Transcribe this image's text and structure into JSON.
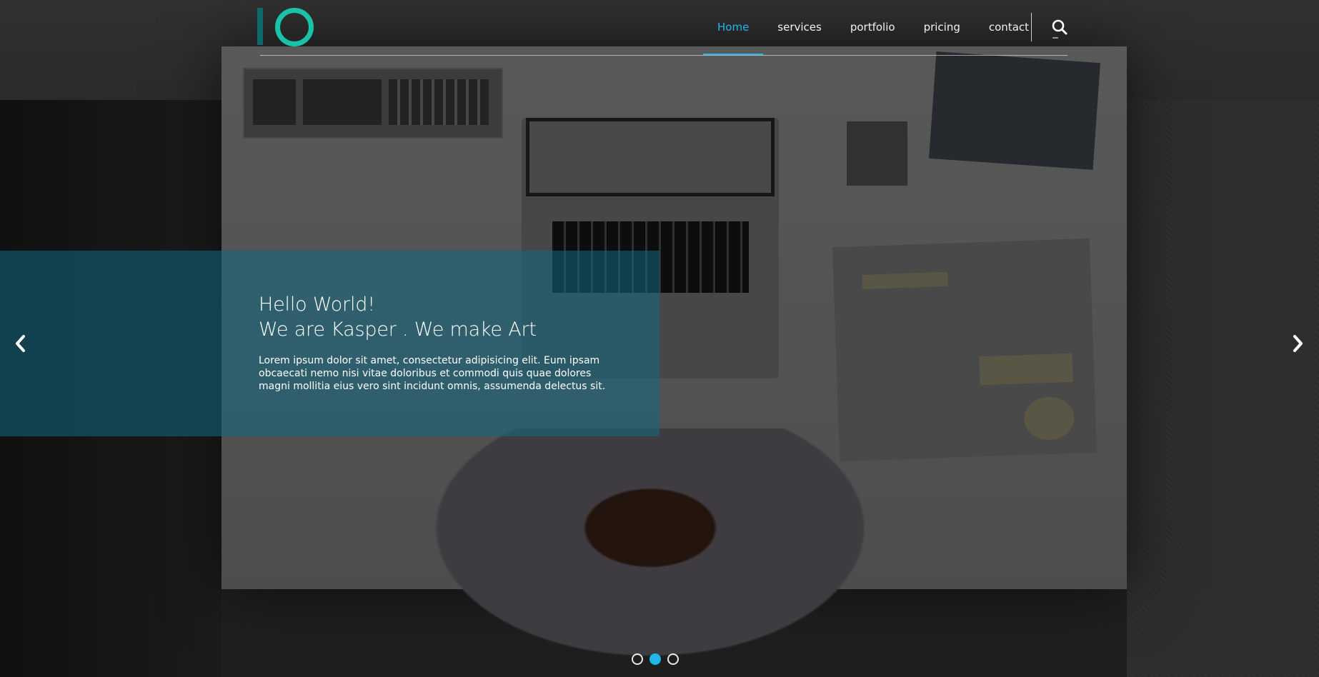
{
  "header": {
    "logo_icon": "ring-logo",
    "nav": [
      {
        "label": "Home",
        "active": true
      },
      {
        "label": "services",
        "active": false
      },
      {
        "label": "portfolio",
        "active": false
      },
      {
        "label": "pricing",
        "active": false
      },
      {
        "label": "contact",
        "active": false
      }
    ],
    "search_icon": "search-icon"
  },
  "slide": {
    "title_line1": "Hello World!",
    "title_line2": "We are Kasper . We make Art",
    "body": "Lorem ipsum dolor sit amet, consectetur adipisicing elit. Eum ipsam obcaecati nemo nisi vitae doloribus et commodi quis quae dolores magni mollitia eius vero sint incidunt omnis, assumenda delectus sit."
  },
  "carousel": {
    "prev_icon": "chevron-left-icon",
    "next_icon": "chevron-right-icon",
    "indicators": [
      {
        "active": false
      },
      {
        "active": true
      },
      {
        "active": false
      }
    ]
  },
  "colors": {
    "accent": "#1fb8e8",
    "logo_teal": "#19c2a8",
    "logo_bar": "#0e6a6a",
    "caption_overlay": "rgba(18,105,130,0.55)"
  }
}
